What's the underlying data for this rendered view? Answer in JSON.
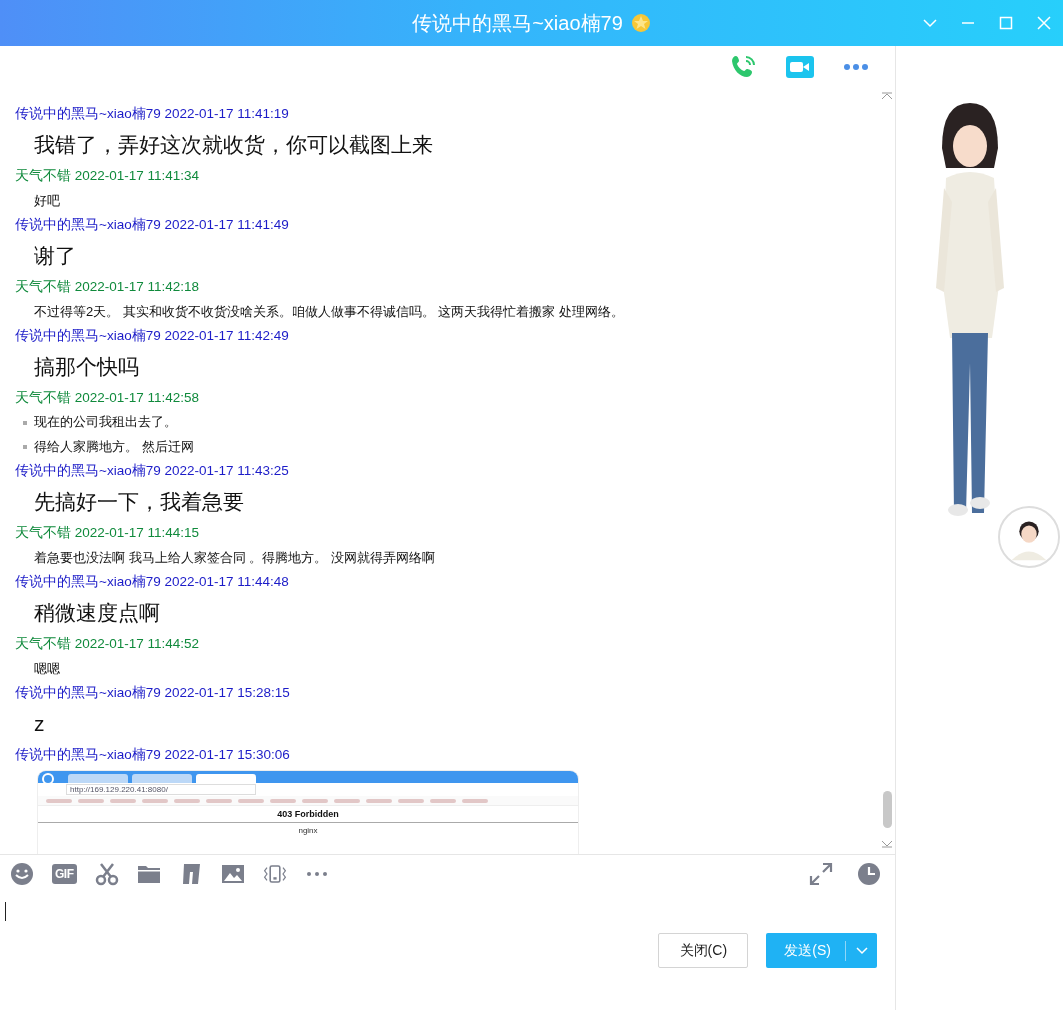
{
  "window": {
    "title": "传说中的黑马~xiao楠79"
  },
  "messages": [
    {
      "sender": "传说中的黑马~xiao楠79",
      "time": "2022-01-17 11:41:19",
      "color": "#1c1cc8",
      "kind": "large",
      "lines": [
        "我错了，弄好这次就收货，你可以截图上来"
      ]
    },
    {
      "sender": "天气不错",
      "time": "2022-01-17 11:41:34",
      "color": "#108a3c",
      "kind": "normal",
      "lines": [
        "好吧"
      ]
    },
    {
      "sender": "传说中的黑马~xiao楠79",
      "time": "2022-01-17 11:41:49",
      "color": "#1c1cc8",
      "kind": "large",
      "lines": [
        "谢了"
      ]
    },
    {
      "sender": "天气不错",
      "time": "2022-01-17 11:42:18",
      "color": "#108a3c",
      "kind": "normal",
      "lines": [
        "不过得等2天。  其实和收货不收货没啥关系。咱做人做事不得诚信吗。  这两天我得忙着搬家 处理网络。"
      ]
    },
    {
      "sender": "传说中的黑马~xiao楠79",
      "time": "2022-01-17 11:42:49",
      "color": "#1c1cc8",
      "kind": "large",
      "lines": [
        "搞那个快吗"
      ]
    },
    {
      "sender": "天气不错",
      "time": "2022-01-17 11:42:58",
      "color": "#108a3c",
      "kind": "bullets",
      "lines": [
        "现在的公司我租出去了。",
        "得给人家腾地方。  然后迁网"
      ]
    },
    {
      "sender": "传说中的黑马~xiao楠79",
      "time": "2022-01-17 11:43:25",
      "color": "#1c1cc8",
      "kind": "large",
      "lines": [
        "先搞好一下，我着急要"
      ]
    },
    {
      "sender": "天气不错",
      "time": "2022-01-17 11:44:15",
      "color": "#108a3c",
      "kind": "normal",
      "lines": [
        "着急要也没法啊 我马上给人家签合同 。得腾地方。 没网就得弄网络啊"
      ]
    },
    {
      "sender": "传说中的黑马~xiao楠79",
      "time": "2022-01-17 11:44:48",
      "color": "#1c1cc8",
      "kind": "large",
      "lines": [
        "稍微速度点啊"
      ]
    },
    {
      "sender": "天气不错",
      "time": "2022-01-17 11:44:52",
      "color": "#108a3c",
      "kind": "normal",
      "lines": [
        "嗯嗯"
      ]
    },
    {
      "sender": "传说中的黑马~xiao楠79",
      "time": "2022-01-17 15:28:15",
      "color": "#1c1cc8",
      "kind": "large",
      "lines": [
        "z"
      ]
    },
    {
      "sender": "传说中的黑马~xiao楠79",
      "time": "2022-01-17 15:30:06",
      "color": "#1c1cc8",
      "kind": "image",
      "screenshot": {
        "url": "http://169.129.220.41:8080/",
        "heading": "403 Forbidden",
        "footer": "nginx"
      }
    }
  ],
  "toolbar": {
    "gif_label": "GIF"
  },
  "buttons": [
    {
      "label": "关闭(C)",
      "kind": "secondary"
    },
    {
      "label": "发送(S)",
      "kind": "primary",
      "has_menu": true
    }
  ]
}
